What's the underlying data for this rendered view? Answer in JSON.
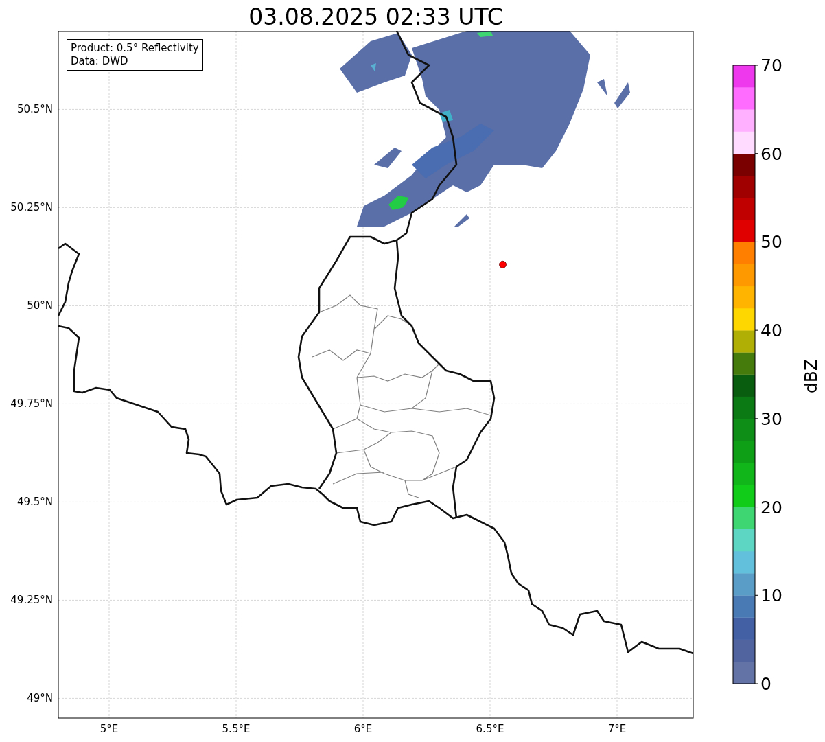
{
  "title": "03.08.2025 02:33 UTC",
  "info_box": [
    "Product: 0.5° Reflectivity",
    "Data: DWD"
  ],
  "map": {
    "chart_data": {
      "type": "scatter",
      "grid": true,
      "xlim": [
        4.8,
        7.3
      ],
      "ylim": [
        48.95,
        50.7
      ],
      "xticks": [
        {
          "value": 5,
          "label": "5°E"
        },
        {
          "value": 5.5,
          "label": "5.5°E"
        },
        {
          "value": 6,
          "label": "6°E"
        },
        {
          "value": 6.5,
          "label": "6.5°E"
        },
        {
          "value": 7,
          "label": "7°E"
        }
      ],
      "yticks": [
        {
          "value": 49,
          "label": "49°N"
        },
        {
          "value": 49.25,
          "label": "49.25°N"
        },
        {
          "value": 49.5,
          "label": "49.5°N"
        },
        {
          "value": 49.75,
          "label": "49.75°N"
        },
        {
          "value": 50,
          "label": "50°N"
        },
        {
          "value": 50.25,
          "label": "50.25°N"
        },
        {
          "value": 50.5,
          "label": "50.5°N"
        }
      ],
      "x": [
        6.55
      ],
      "series": [
        {
          "color": "#ff0000",
          "values": [
            50.105
          ]
        }
      ]
    }
  },
  "colorbar": {
    "label": "dBZ",
    "ticks": [
      "70",
      "60",
      "50",
      "40",
      "30",
      "20",
      "10",
      "0"
    ],
    "segments": [
      {
        "color": "#6473a6"
      },
      {
        "color": "#52649f"
      },
      {
        "color": "#4360a5"
      },
      {
        "color": "#4a7ab4"
      },
      {
        "color": "#5a9dc6"
      },
      {
        "color": "#63c0dc"
      },
      {
        "color": "#5ed6c4"
      },
      {
        "color": "#3dd672"
      },
      {
        "color": "#12cc1a"
      },
      {
        "color": "#10b61a"
      },
      {
        "color": "#0f9f17"
      },
      {
        "color": "#0e8e16"
      },
      {
        "color": "#0b7a14"
      },
      {
        "color": "#085e0e"
      },
      {
        "color": "#457a0c"
      },
      {
        "color": "#afaf06"
      },
      {
        "color": "#ffd700"
      },
      {
        "color": "#ffb400"
      },
      {
        "color": "#ff9900"
      },
      {
        "color": "#ff7f00"
      },
      {
        "color": "#e00000"
      },
      {
        "color": "#c00000"
      },
      {
        "color": "#a00000"
      },
      {
        "color": "#7a0000"
      },
      {
        "color": "#ffdcff"
      },
      {
        "color": "#ffb0ff"
      },
      {
        "color": "#ff6cff"
      },
      {
        "color": "#ee38ee"
      }
    ]
  }
}
